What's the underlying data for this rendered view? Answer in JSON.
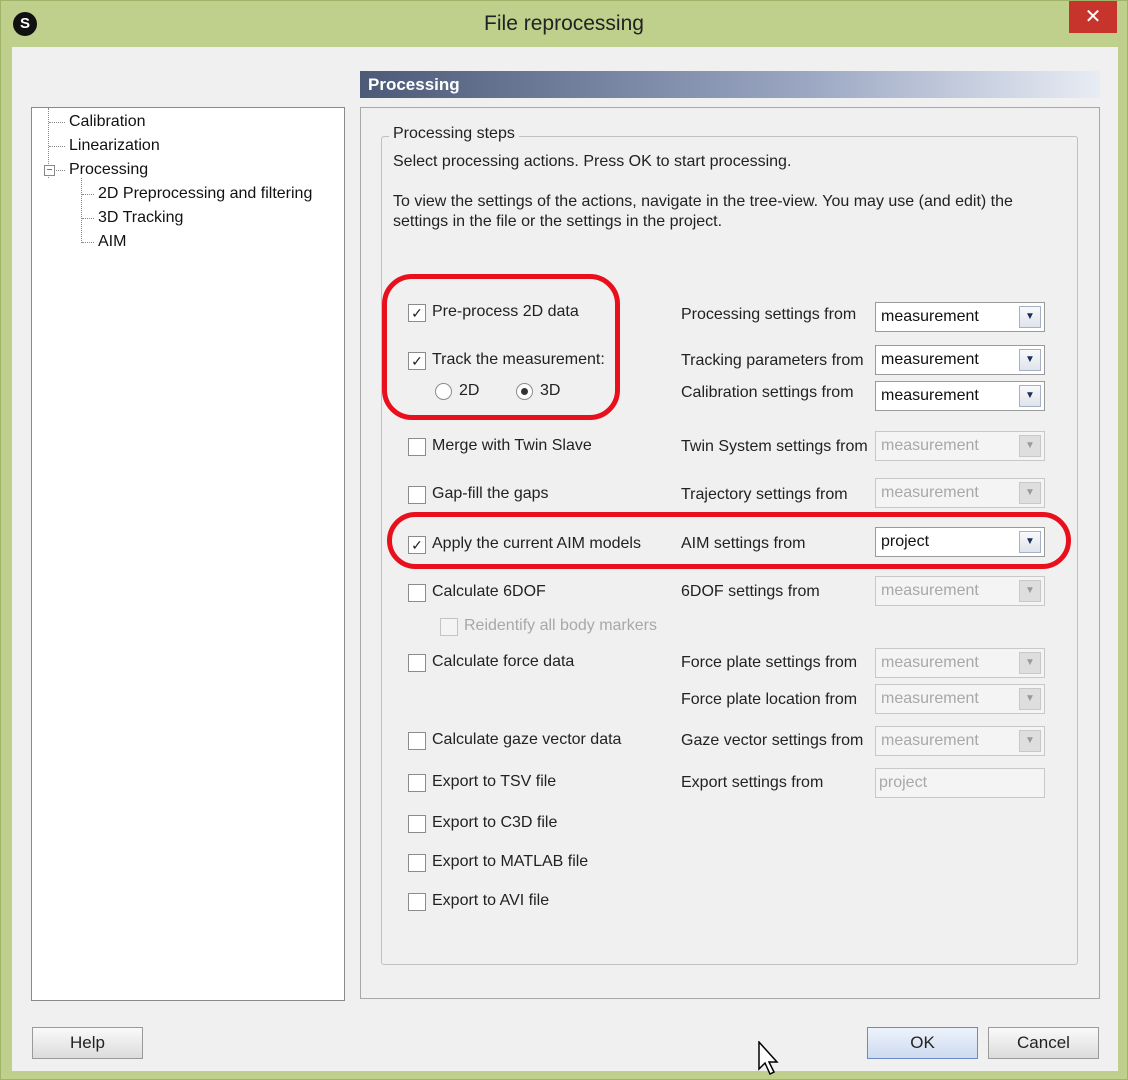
{
  "window": {
    "title": "File reprocessing",
    "close_glyph": "✕"
  },
  "tree": {
    "items": [
      {
        "label": "Calibration"
      },
      {
        "label": "Linearization"
      },
      {
        "label": "Processing"
      },
      {
        "label": "2D Preprocessing and filtering"
      },
      {
        "label": "3D Tracking"
      },
      {
        "label": "AIM"
      }
    ]
  },
  "section": {
    "header": "Processing"
  },
  "group": {
    "title": "Processing steps",
    "line1": "Select processing actions. Press OK to start processing.",
    "line2": "To view the settings of the actions, navigate in the tree-view. You may use (and edit) the",
    "line3": "settings in the file or the settings in the project."
  },
  "steps": {
    "preprocess": {
      "label": "Pre-process 2D data",
      "checked": true
    },
    "track": {
      "label": "Track the measurement:",
      "checked": true
    },
    "radio_2d": {
      "label": "2D",
      "selected": false
    },
    "radio_3d": {
      "label": "3D",
      "selected": true
    },
    "merge": {
      "label": "Merge with Twin Slave",
      "checked": false
    },
    "gapfill": {
      "label": "Gap-fill the gaps",
      "checked": false
    },
    "aim": {
      "label": "Apply the current AIM models",
      "checked": true
    },
    "sixdof": {
      "label": "Calculate 6DOF",
      "checked": false
    },
    "reidentify": {
      "label": "Reidentify all body markers",
      "checked": false,
      "enabled": false
    },
    "force": {
      "label": "Calculate force data",
      "checked": false
    },
    "gaze": {
      "label": "Calculate gaze vector data",
      "checked": false
    },
    "tsv": {
      "label": "Export to TSV file",
      "checked": false
    },
    "c3d": {
      "label": "Export to C3D file",
      "checked": false
    },
    "matlab": {
      "label": "Export to MATLAB file",
      "checked": false
    },
    "avi": {
      "label": "Export to AVI file",
      "checked": false
    }
  },
  "settings": {
    "processing": {
      "label": "Processing settings from",
      "value": "measurement",
      "enabled": true
    },
    "tracking": {
      "label": "Tracking parameters from",
      "value": "measurement",
      "enabled": true
    },
    "calibration": {
      "label": "Calibration settings from",
      "value": "measurement",
      "enabled": true
    },
    "twin": {
      "label": "Twin System settings from",
      "value": "measurement",
      "enabled": false
    },
    "trajectory": {
      "label": "Trajectory settings from",
      "value": "measurement",
      "enabled": false
    },
    "aim": {
      "label": "AIM settings from",
      "value": "project",
      "enabled": true
    },
    "sixdof": {
      "label": "6DOF settings from",
      "value": "measurement",
      "enabled": false
    },
    "forceplate": {
      "label": "Force plate settings from",
      "value": "measurement",
      "enabled": false
    },
    "forcelocation": {
      "label": "Force plate location from",
      "value": "measurement",
      "enabled": false
    },
    "gaze": {
      "label": "Gaze vector settings from",
      "value": "measurement",
      "enabled": false
    },
    "export": {
      "label": "Export settings from",
      "value": "project",
      "enabled": false
    }
  },
  "buttons": {
    "help": "Help",
    "ok": "OK",
    "cancel": "Cancel"
  },
  "icons": {
    "dropdown": "▼",
    "check": "✓",
    "expander": "−"
  },
  "colors": {
    "highlight": "#e8101c",
    "titlebar": "#bfd08c",
    "close": "#c7342c"
  }
}
